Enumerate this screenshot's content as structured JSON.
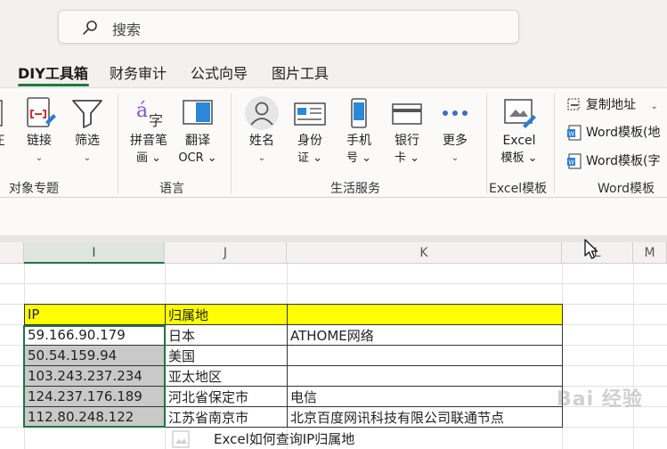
{
  "search": {
    "placeholder": "搜索"
  },
  "tabs": [
    {
      "label": "DIY工具箱",
      "active": true
    },
    {
      "label": "财务审计"
    },
    {
      "label": "公式向导"
    },
    {
      "label": "图片工具"
    }
  ],
  "ribbon": {
    "partial_left": {
      "label": "圧"
    },
    "groups": {
      "object": {
        "label": "对象专题",
        "buttons": [
          {
            "label1": "链接",
            "label2": "⌄"
          },
          {
            "label1": "筛选",
            "label2": "⌄"
          }
        ]
      },
      "language": {
        "label": "语言",
        "buttons": [
          {
            "label1": "拼音笔",
            "label2": "画 ⌄"
          },
          {
            "label1": "翻译",
            "label2": "OCR ⌄"
          }
        ]
      },
      "life": {
        "label": "生活服务",
        "buttons": [
          {
            "label1": "姓名",
            "label2": "⌄"
          },
          {
            "label1": "身份",
            "label2": "证 ⌄"
          },
          {
            "label1": "手机",
            "label2": "号 ⌄"
          },
          {
            "label1": "银行",
            "label2": "卡 ⌄"
          },
          {
            "label1": "更多",
            "label2": "⌄"
          }
        ]
      },
      "excel_template": {
        "label": "Excel模板",
        "buttons": [
          {
            "label1": "Excel",
            "label2": "模板 ⌄"
          }
        ]
      },
      "word_template": {
        "label": "Word模板",
        "items": [
          {
            "label": "复制地址",
            "caret": "⌄"
          },
          {
            "label": "Word模板(地"
          },
          {
            "label": "Word模板(字"
          }
        ]
      }
    }
  },
  "sheet": {
    "columns": [
      "I",
      "J",
      "K",
      "L",
      "M"
    ],
    "header_row": [
      "IP",
      "归属地",
      ""
    ],
    "rows": [
      [
        "59.166.90.179",
        "日本",
        "ATHOME网络"
      ],
      [
        "50.54.159.94",
        "美国",
        ""
      ],
      [
        "103.243.237.234",
        "亚太地区",
        ""
      ],
      [
        "124.237.176.189",
        "河北省保定市",
        "电信"
      ],
      [
        "112.80.248.122",
        "江苏省南京市",
        "北京百度网讯科技有限公司联通节点"
      ]
    ]
  },
  "caption": "Excel如何查询IP归属地",
  "watermark": "Bai 经验",
  "colors": {
    "accent": "#217346",
    "header_fill": "#ffff00",
    "selection_fill": "#c9c9c9"
  }
}
